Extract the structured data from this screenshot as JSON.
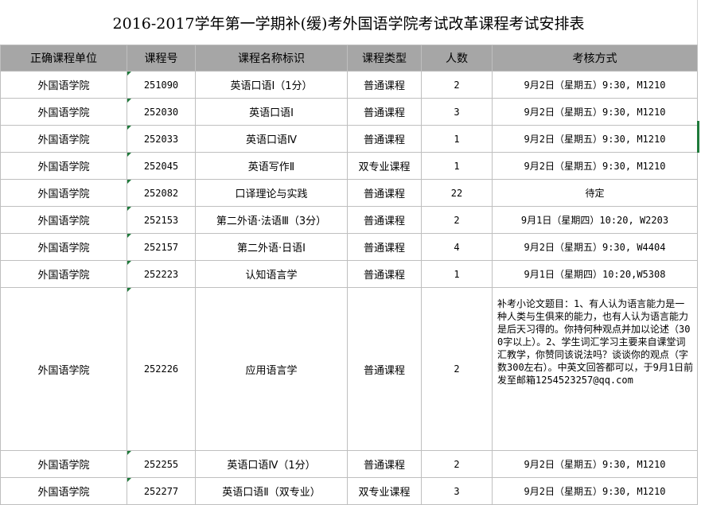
{
  "title": "2016-2017学年第一学期补(缓)考外国语学院考试改革课程考试安排表",
  "headers": [
    "正确课程单位",
    "课程号",
    "课程名称标识",
    "课程类型",
    "人数",
    "考核方式"
  ],
  "rows": [
    {
      "unit": "外国语学院",
      "code": "251090",
      "name": "英语口语Ⅰ（1分）",
      "type": "普通课程",
      "count": "2",
      "method": "9月2日（星期五）9:30, M1210"
    },
    {
      "unit": "外国语学院",
      "code": "252030",
      "name": "英语口语Ⅰ",
      "type": "普通课程",
      "count": "3",
      "method": "9月2日（星期五）9:30, M1210"
    },
    {
      "unit": "外国语学院",
      "code": "252033",
      "name": "英语口语Ⅳ",
      "type": "普通课程",
      "count": "1",
      "method": "9月2日（星期五）9:30, M1210"
    },
    {
      "unit": "外国语学院",
      "code": "252045",
      "name": "英语写作Ⅱ",
      "type": "双专业课程",
      "count": "1",
      "method": "9月2日（星期五）9:30, M1210"
    },
    {
      "unit": "外国语学院",
      "code": "252082",
      "name": "口译理论与实践",
      "type": "普通课程",
      "count": "22",
      "method": "待定"
    },
    {
      "unit": "外国语学院",
      "code": "252153",
      "name": "第二外语·法语Ⅲ（3分）",
      "type": "普通课程",
      "count": "2",
      "method": "9月1日（星期四）10:20, W2203"
    },
    {
      "unit": "外国语学院",
      "code": "252157",
      "name": "第二外语·日语Ⅰ",
      "type": "普通课程",
      "count": "4",
      "method": "9月2日（星期五）9:30, W4404"
    },
    {
      "unit": "外国语学院",
      "code": "252223",
      "name": "认知语言学",
      "type": "普通课程",
      "count": "1",
      "method": "9月1日（星期四）10:20,W5308"
    },
    {
      "unit": "外国语学院",
      "code": "252226",
      "name": "应用语言学",
      "type": "普通课程",
      "count": "2",
      "method": "补考小论文题目：1、有人认为语言能力是一种人类与生俱来的能力，也有人认为语言能力是后天习得的。你持何种观点并加以论述（300字以上）。2、学生词汇学习主要来自课堂词汇教学，你赞同该说法吗？谈谈你的观点（字数300左右）。中英文回答都可以，于9月1日前发至邮箱1254523257@qq.com"
    },
    {
      "unit": "外国语学院",
      "code": "252255",
      "name": "英语口语Ⅳ（1分）",
      "type": "普通课程",
      "count": "2",
      "method": "9月2日（星期五）9:30, M1210"
    },
    {
      "unit": "外国语学院",
      "code": "252277",
      "name": "英语口语Ⅱ（双专业）",
      "type": "双专业课程",
      "count": "3",
      "method": "9月2日（星期五）9:30, M1210"
    }
  ]
}
